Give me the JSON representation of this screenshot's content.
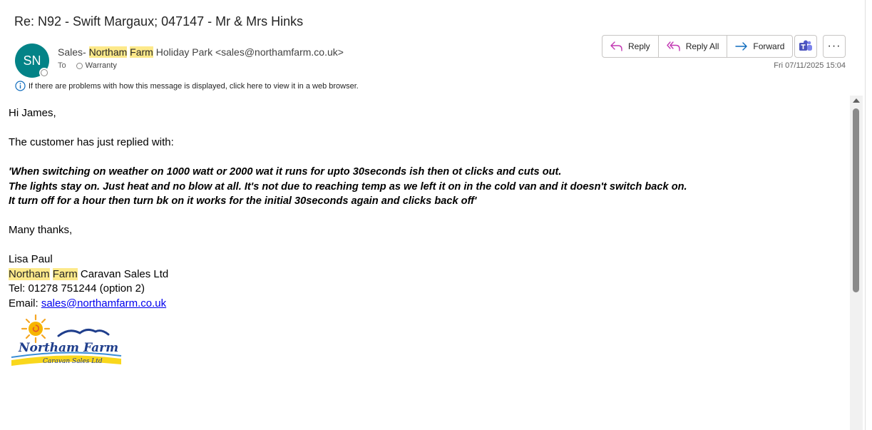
{
  "email": {
    "subject": "Re: N92 - Swift Margaux; 047147 - Mr & Mrs Hinks",
    "avatar_initials": "SN",
    "sender": {
      "prefix": "Sales- ",
      "hl1": "Northam",
      "space": " ",
      "hl2": "Farm",
      "suffix": " Holiday Park <sales@northamfarm.co.uk>"
    },
    "to_label": "To",
    "recipient": "Warranty",
    "date": "Fri 07/11/2025 15:04",
    "info_message": "If there are problems with how this message is displayed, click here to view it in a web browser."
  },
  "actions": {
    "reply": "Reply",
    "reply_all": "Reply All",
    "forward": "Forward",
    "more": "···"
  },
  "body": {
    "greeting": "Hi James,",
    "intro": "The customer has just replied with:",
    "quote_lines": [
      "'When switching on weather on 1000 watt or 2000 wat it runs for upto 30seconds ish then ot clicks and cuts out.",
      "The lights stay on. Just heat and no blow at all. It's not due to reaching temp as we left it on in the cold van and it doesn't switch back on.",
      "It turn off for a hour then turn bk on it works for the initial 30seconds again and clicks back off'"
    ],
    "signoff": "Many thanks,",
    "signature": {
      "name": "Lisa Paul",
      "company_hl1": "Northam",
      "company_hl2": "Farm",
      "company_rest": " Caravan Sales Ltd",
      "tel": "Tel: 01278 751244 (option 2)",
      "email_label": "Email: ",
      "email_link": "sales@northamfarm.co.uk"
    },
    "logo": {
      "title": "Northam Farm",
      "subtitle": "Caravan Sales Ltd"
    }
  },
  "colors": {
    "avatar": "#038387",
    "highlight": "#fde98a",
    "link": "#0000ee",
    "reply_icon": "#c239b3",
    "forward_icon": "#0f6cbd"
  }
}
